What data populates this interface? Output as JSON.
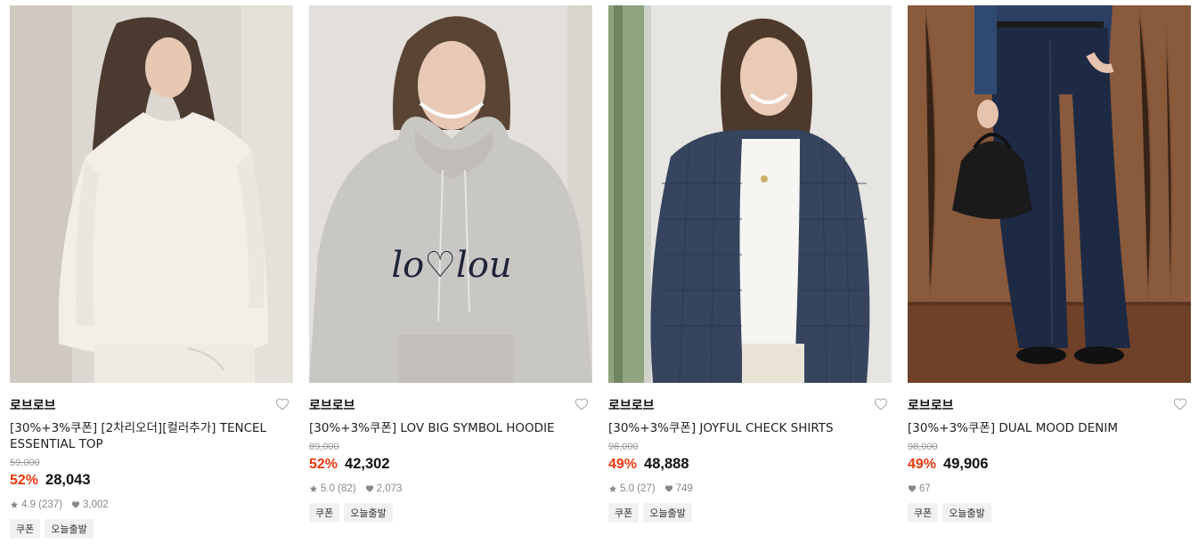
{
  "products": [
    {
      "brand": "로브로브",
      "title": "[30%+3%쿠폰] [2차리오더][컬러추가] TENCEL ESSENTIAL TOP",
      "original_price": "59,000",
      "discount": "52%",
      "price": "28,043",
      "rating": "4.9 (237)",
      "likes": "3,002",
      "badges": [
        "쿠폰",
        "오늘출발"
      ],
      "image": "woman-in-white-longsleeve-top"
    },
    {
      "brand": "로브로브",
      "title": "[30%+3%쿠폰] LOV BIG SYMBOL HOODIE",
      "original_price": "89,000",
      "discount": "52%",
      "price": "42,302",
      "rating": "5.0 (82)",
      "likes": "2,073",
      "badges": [
        "쿠폰",
        "오늘출발"
      ],
      "image": "woman-in-grey-hoodie",
      "print_text": "lo♡lou"
    },
    {
      "brand": "로브로브",
      "title": "[30%+3%쿠폰] JOYFUL CHECK SHIRTS",
      "original_price": "96,000",
      "discount": "49%",
      "price": "48,888",
      "rating": "5.0 (27)",
      "likes": "749",
      "badges": [
        "쿠폰",
        "오늘출발"
      ],
      "image": "woman-in-navy-check-shirt"
    },
    {
      "brand": "로브로브",
      "title": "[30%+3%쿠폰] DUAL MOOD DENIM",
      "original_price": "98,000",
      "discount": "49%",
      "price": "49,906",
      "rating": "",
      "likes": "67",
      "badges": [
        "쿠폰",
        "오늘출발"
      ],
      "image": "model-in-wide-denim-with-black-bag"
    }
  ],
  "colors": {
    "discount": "#e8370f",
    "badge_bg": "#f1f1f1",
    "meta_gray": "#888888"
  },
  "icons": {
    "wishlist": "heart-outline-icon",
    "rating": "star-icon",
    "likes": "heart-filled-icon"
  }
}
